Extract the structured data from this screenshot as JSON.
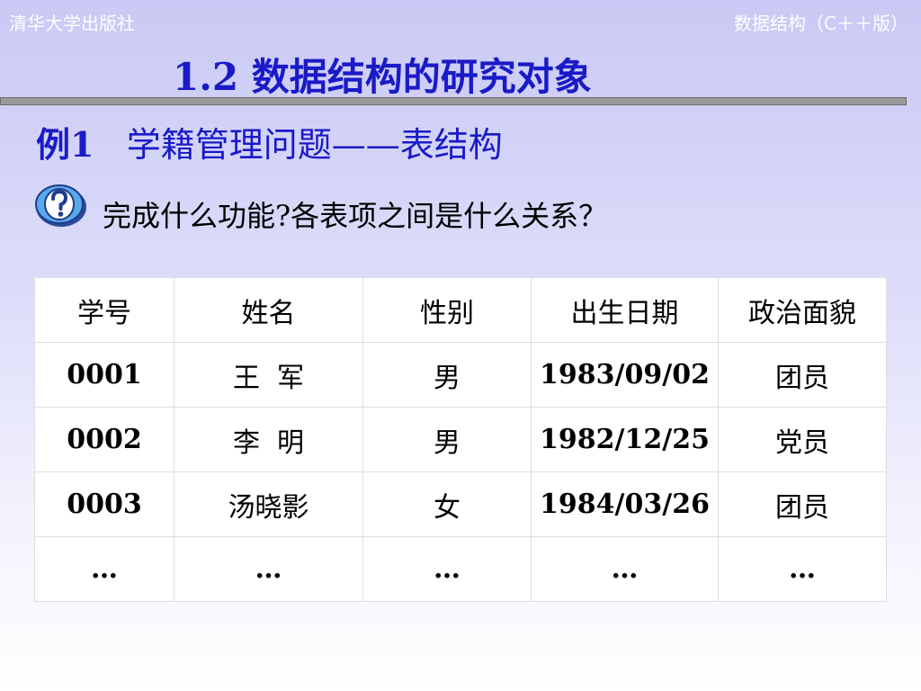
{
  "header": {
    "publisher": "清华大学出版社",
    "book": "数据结构（C＋＋版）"
  },
  "slide": {
    "title": "1.2  数据结构的研究对象",
    "example_label": "例1",
    "example_title": "学籍管理问题——表结构",
    "question_icon": "question-mark-icon",
    "question": "完成什么功能?各表项之间是什么关系？"
  },
  "table": {
    "headers": [
      "学号",
      "姓名",
      "性别",
      "出生日期",
      "政治面貌"
    ],
    "rows": [
      [
        "0001",
        "王  军",
        "男",
        "1983/09/02",
        "团员"
      ],
      [
        "0002",
        "李  明",
        "男",
        "1982/12/25",
        "党员"
      ],
      [
        "0003",
        "汤晓影",
        "女",
        "1984/03/26",
        "团员"
      ],
      [
        "…",
        "…",
        "…",
        "…",
        "…"
      ]
    ]
  },
  "colors": {
    "title_blue": "#1a1ac8",
    "header_text": "#ffffff",
    "icon_blue": "#5aa8e8"
  }
}
